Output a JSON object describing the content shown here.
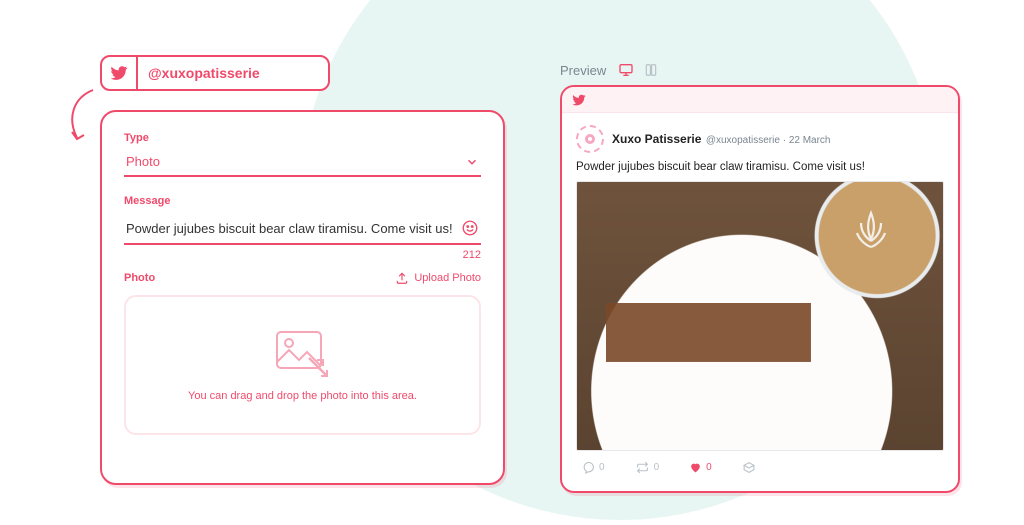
{
  "handle": {
    "username": "@xuxopatisserie"
  },
  "form": {
    "type_label": "Type",
    "type_value": "Photo",
    "message_label": "Message",
    "message_value": "Powder jujubes biscuit bear claw tiramisu. Come visit us!",
    "char_count": "212",
    "photo_label": "Photo",
    "upload_label": "Upload Photo",
    "dropzone_hint": "You can drag and drop the photo into this area."
  },
  "preview": {
    "label": "Preview",
    "account_name": "Xuxo Patisserie",
    "account_handle": "@xuxopatisserie",
    "timestamp": "22 March",
    "body": "Powder jujubes biscuit bear claw tiramisu. Come visit us!",
    "counts": {
      "reply": "0",
      "retweet": "0",
      "like": "0"
    }
  }
}
